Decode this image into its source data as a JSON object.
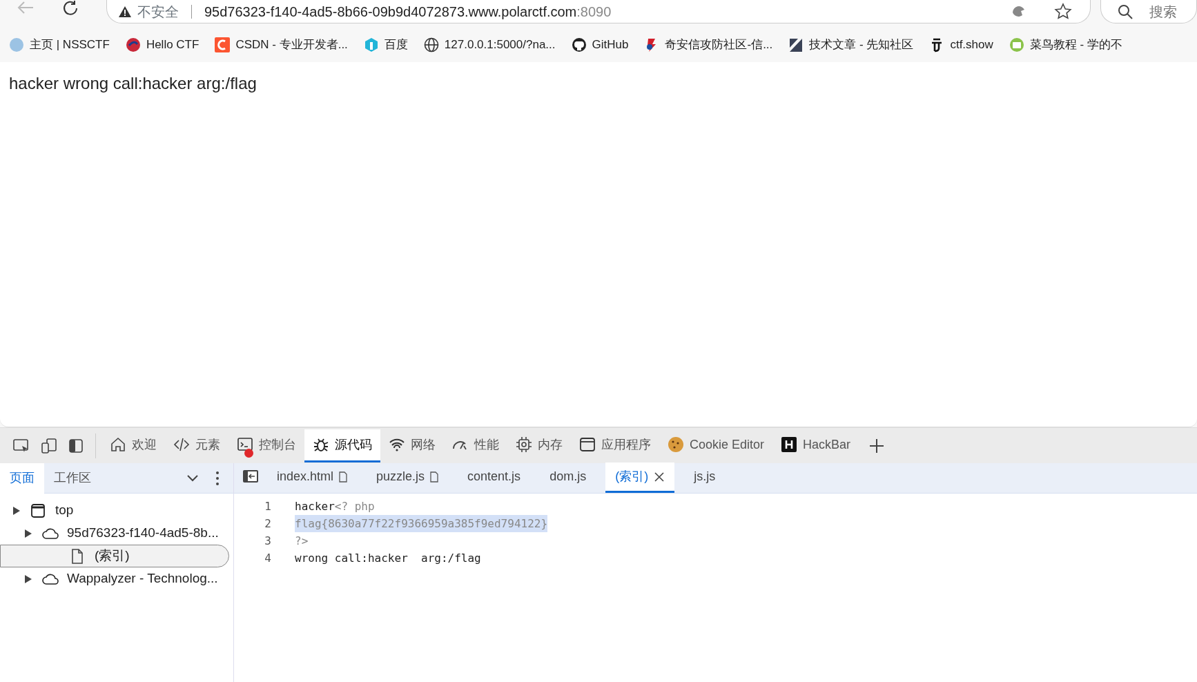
{
  "address_bar": {
    "security": "不安全",
    "url_host": "95d76323-f140-4ad5-8b66-09b9d4072873.www.polarctf.com",
    "url_port": ":8090",
    "search_placeholder": "搜索"
  },
  "bookmarks": [
    {
      "label": "主页 | NSSCTF"
    },
    {
      "label": "Hello CTF"
    },
    {
      "label": "CSDN - 专业开发者..."
    },
    {
      "label": "百度"
    },
    {
      "label": "127.0.0.1:5000/?na..."
    },
    {
      "label": "GitHub"
    },
    {
      "label": "奇安信攻防社区-信..."
    },
    {
      "label": "技术文章 - 先知社区"
    },
    {
      "label": "ctf.show"
    },
    {
      "label": "菜鸟教程 - 学的不"
    }
  ],
  "page": {
    "text": "hacker wrong call:hacker arg:/flag"
  },
  "devtools": {
    "tabs": [
      {
        "label": "欢迎",
        "selected": false,
        "has_error": false
      },
      {
        "label": "元素",
        "selected": false,
        "has_error": false
      },
      {
        "label": "控制台",
        "selected": false,
        "has_error": true
      },
      {
        "label": "源代码",
        "selected": true,
        "has_error": false
      },
      {
        "label": "网络",
        "selected": false,
        "has_error": false
      },
      {
        "label": "性能",
        "selected": false,
        "has_error": false
      },
      {
        "label": "内存",
        "selected": false,
        "has_error": false
      },
      {
        "label": "应用程序",
        "selected": false,
        "has_error": false
      },
      {
        "label": "Cookie Editor",
        "selected": false,
        "has_error": false
      },
      {
        "label": "HackBar",
        "selected": false,
        "has_error": false
      }
    ],
    "navigator_tabs": [
      {
        "label": "页面",
        "selected": true
      },
      {
        "label": "工作区",
        "selected": false
      }
    ],
    "tree": [
      {
        "kind": "frame",
        "label": "top",
        "selected": false,
        "children": [
          {
            "kind": "origin",
            "label": "95d76323-f140-4ad5-8b...",
            "selected": false,
            "children": [
              {
                "kind": "file",
                "label": "(索引)",
                "selected": true
              }
            ]
          },
          {
            "kind": "origin",
            "label": "Wappalyzer - Technolog...",
            "selected": false
          }
        ]
      }
    ],
    "editor_tabs": [
      {
        "label": "index.html",
        "selected": false,
        "file_icon": true
      },
      {
        "label": "puzzle.js",
        "selected": false,
        "file_icon": true
      },
      {
        "label": "content.js",
        "selected": false,
        "file_icon": false
      },
      {
        "label": "dom.js",
        "selected": false,
        "file_icon": false
      },
      {
        "label": "(索引)",
        "selected": true,
        "file_icon": false
      },
      {
        "label": "js.js",
        "selected": false,
        "file_icon": false
      }
    ],
    "code_lines": [
      {
        "number": "1",
        "highlighted": false,
        "segments": [
          {
            "kind": "text",
            "text": "hacker"
          },
          {
            "kind": "tag",
            "text": "<? php"
          }
        ]
      },
      {
        "number": "2",
        "highlighted": true,
        "segments": [
          {
            "kind": "tag",
            "text": "flag{8630a77f22f9366959a385f9ed794122}"
          }
        ]
      },
      {
        "number": "3",
        "highlighted": false,
        "segments": [
          {
            "kind": "tag",
            "text": "?>"
          }
        ]
      },
      {
        "number": "4",
        "highlighted": false,
        "segments": [
          {
            "kind": "text",
            "text": "wrong call:hacker  arg:/flag"
          }
        ]
      }
    ]
  }
}
